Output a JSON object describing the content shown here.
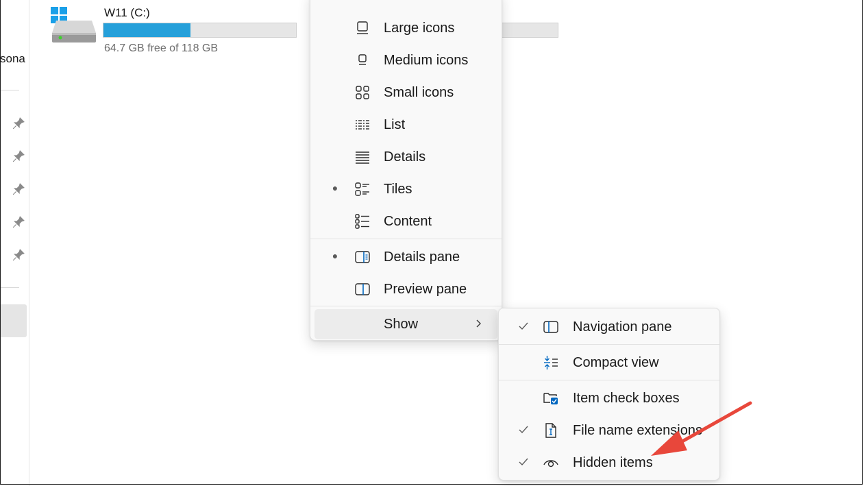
{
  "nav": {
    "partial_label": "sona"
  },
  "drive": {
    "title": "W11 (C:)",
    "usage_text": "64.7 GB free of 118 GB",
    "used_fraction": 0.452
  },
  "view_menu": {
    "items": [
      {
        "label": "Large icons",
        "icon": "large-icons-icon",
        "selected": false
      },
      {
        "label": "Medium icons",
        "icon": "medium-icons-icon",
        "selected": false
      },
      {
        "label": "Small icons",
        "icon": "small-icons-icon",
        "selected": false
      },
      {
        "label": "List",
        "icon": "list-icon",
        "selected": false
      },
      {
        "label": "Details",
        "icon": "details-icon",
        "selected": false
      },
      {
        "label": "Tiles",
        "icon": "tiles-icon",
        "selected": true
      },
      {
        "label": "Content",
        "icon": "content-icon",
        "selected": false
      }
    ],
    "panes": [
      {
        "label": "Details pane",
        "icon": "details-pane-icon",
        "selected": true
      },
      {
        "label": "Preview pane",
        "icon": "preview-pane-icon",
        "selected": false
      }
    ],
    "show_label": "Show"
  },
  "show_submenu": {
    "items": [
      {
        "label": "Navigation pane",
        "icon": "navigation-pane-icon",
        "checked": true
      },
      {
        "label": "Compact view",
        "icon": "compact-view-icon",
        "checked": false
      },
      {
        "label": "Item check boxes",
        "icon": "item-check-boxes-icon",
        "checked": false
      },
      {
        "label": "File name extensions",
        "icon": "file-name-extensions-icon",
        "checked": true
      },
      {
        "label": "Hidden items",
        "icon": "hidden-items-icon",
        "checked": true
      }
    ]
  },
  "colors": {
    "accent": "#26a0da",
    "icon_blue": "#0067c0",
    "annotation_arrow": "#e8473b"
  }
}
